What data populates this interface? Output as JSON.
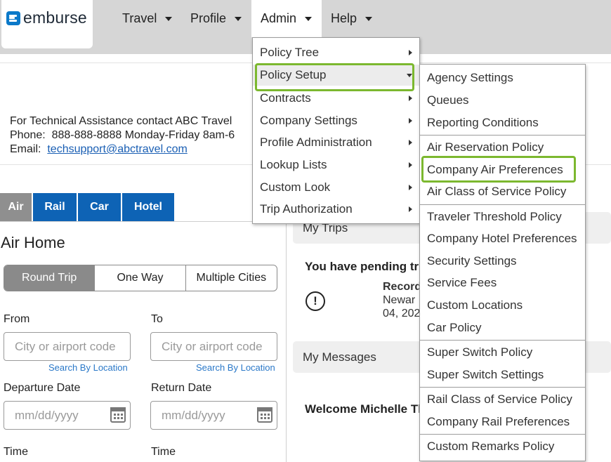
{
  "brand": {
    "name": "emburse",
    "color": "#0b79c9"
  },
  "nav": {
    "items": [
      {
        "label": "Travel"
      },
      {
        "label": "Profile"
      },
      {
        "label": "Admin"
      },
      {
        "label": "Help"
      }
    ]
  },
  "tech_support": {
    "heading": "For Technical Assistance contact ABC Travel",
    "phone_label": "Phone:",
    "phone_value": "888-888-8888 Monday-Friday 8am-6",
    "email_label": "Email:",
    "email_value": "techsupport@abctravel.com"
  },
  "mode_tabs": [
    {
      "label": "Air"
    },
    {
      "label": "Rail"
    },
    {
      "label": "Car"
    },
    {
      "label": "Hotel"
    }
  ],
  "air_home": {
    "title": "Air Home",
    "trip_types": [
      "Round Trip",
      "One Way",
      "Multiple Cities"
    ],
    "from_label": "From",
    "to_label": "To",
    "airport_placeholder": "City or airport code",
    "search_by_location": "Search By Location",
    "departure_label": "Departure Date",
    "return_label": "Return Date",
    "date_placeholder": "mm/dd/yyyy",
    "time_label": "Time"
  },
  "right_panel": {
    "my_trips": "My Trips",
    "pending": "You have pending tri",
    "record_line1": "Record",
    "record_line2": "Newar",
    "record_line3": "04, 202",
    "my_messages": "My Messages",
    "welcome": "Welcome Michelle Th"
  },
  "admin_menu": {
    "items": [
      "Policy Tree",
      "Policy Setup",
      "Contracts",
      "Company Settings",
      "Profile Administration",
      "Lookup Lists",
      "Custom Look",
      "Trip Authorization"
    ]
  },
  "policy_setup_menu": {
    "items": [
      "Agency Settings",
      "Queues",
      "Reporting Conditions",
      "Air Reservation Policy",
      "Company Air Preferences",
      "Air Class of Service Policy",
      "Traveler Threshold Policy",
      "Company Hotel Preferences",
      "Security Settings",
      "Service Fees",
      "Custom Locations",
      "Car Policy",
      "Super Switch Policy",
      "Super Switch Settings",
      "Rail Class of Service Policy",
      "Company Rail Preferences",
      "Custom Remarks Policy"
    ]
  },
  "highlight_color": "#7cb82f"
}
